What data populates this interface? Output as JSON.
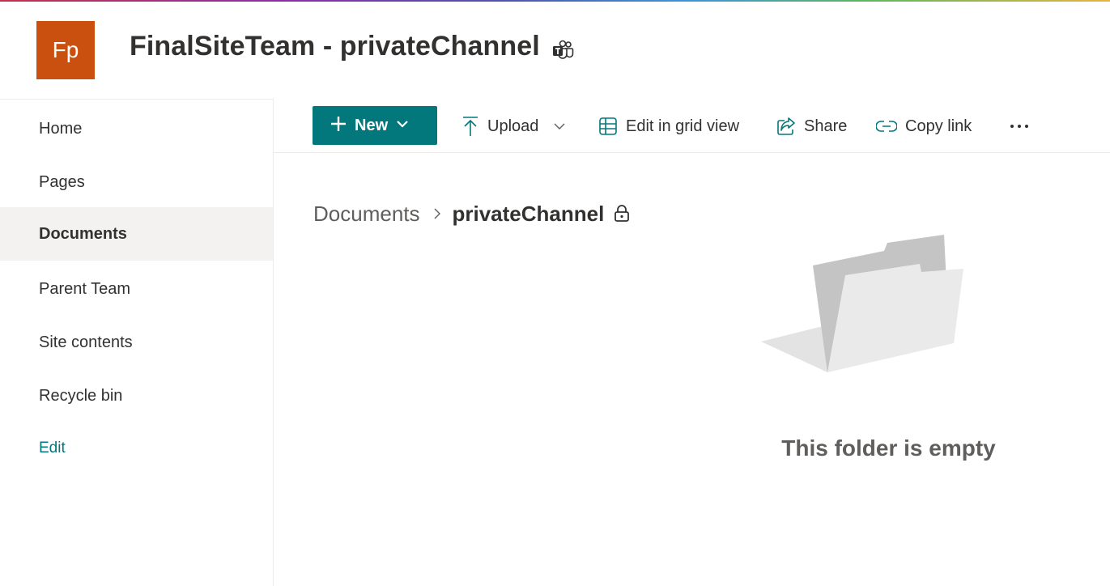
{
  "header": {
    "logo_initials": "Fp",
    "logo_color": "#ca5010",
    "site_title": "FinalSiteTeam - privateChannel",
    "teams_icon": "teams-icon"
  },
  "nav": {
    "items": [
      {
        "label": "Home",
        "selected": false
      },
      {
        "label": "Pages",
        "selected": false
      },
      {
        "label": "Documents",
        "selected": true
      },
      {
        "label": "Parent Team",
        "selected": false
      },
      {
        "label": "Site contents",
        "selected": false
      },
      {
        "label": "Recycle bin",
        "selected": false
      }
    ],
    "edit_label": "Edit"
  },
  "commandbar": {
    "new_label": "New",
    "upload_label": "Upload",
    "grid_label": "Edit in grid view",
    "share_label": "Share",
    "copylink_label": "Copy link",
    "more_icon": "more-icon"
  },
  "breadcrumb": {
    "root": "Documents",
    "current": "privateChannel",
    "lock_icon": "lock-icon"
  },
  "empty_state": {
    "message": "This folder is empty",
    "illustration": "empty-folder-illustration"
  },
  "colors": {
    "accent": "#03787c",
    "selected_bg": "#f3f2f1",
    "text": "#323130",
    "secondary_text": "#605e5c"
  }
}
